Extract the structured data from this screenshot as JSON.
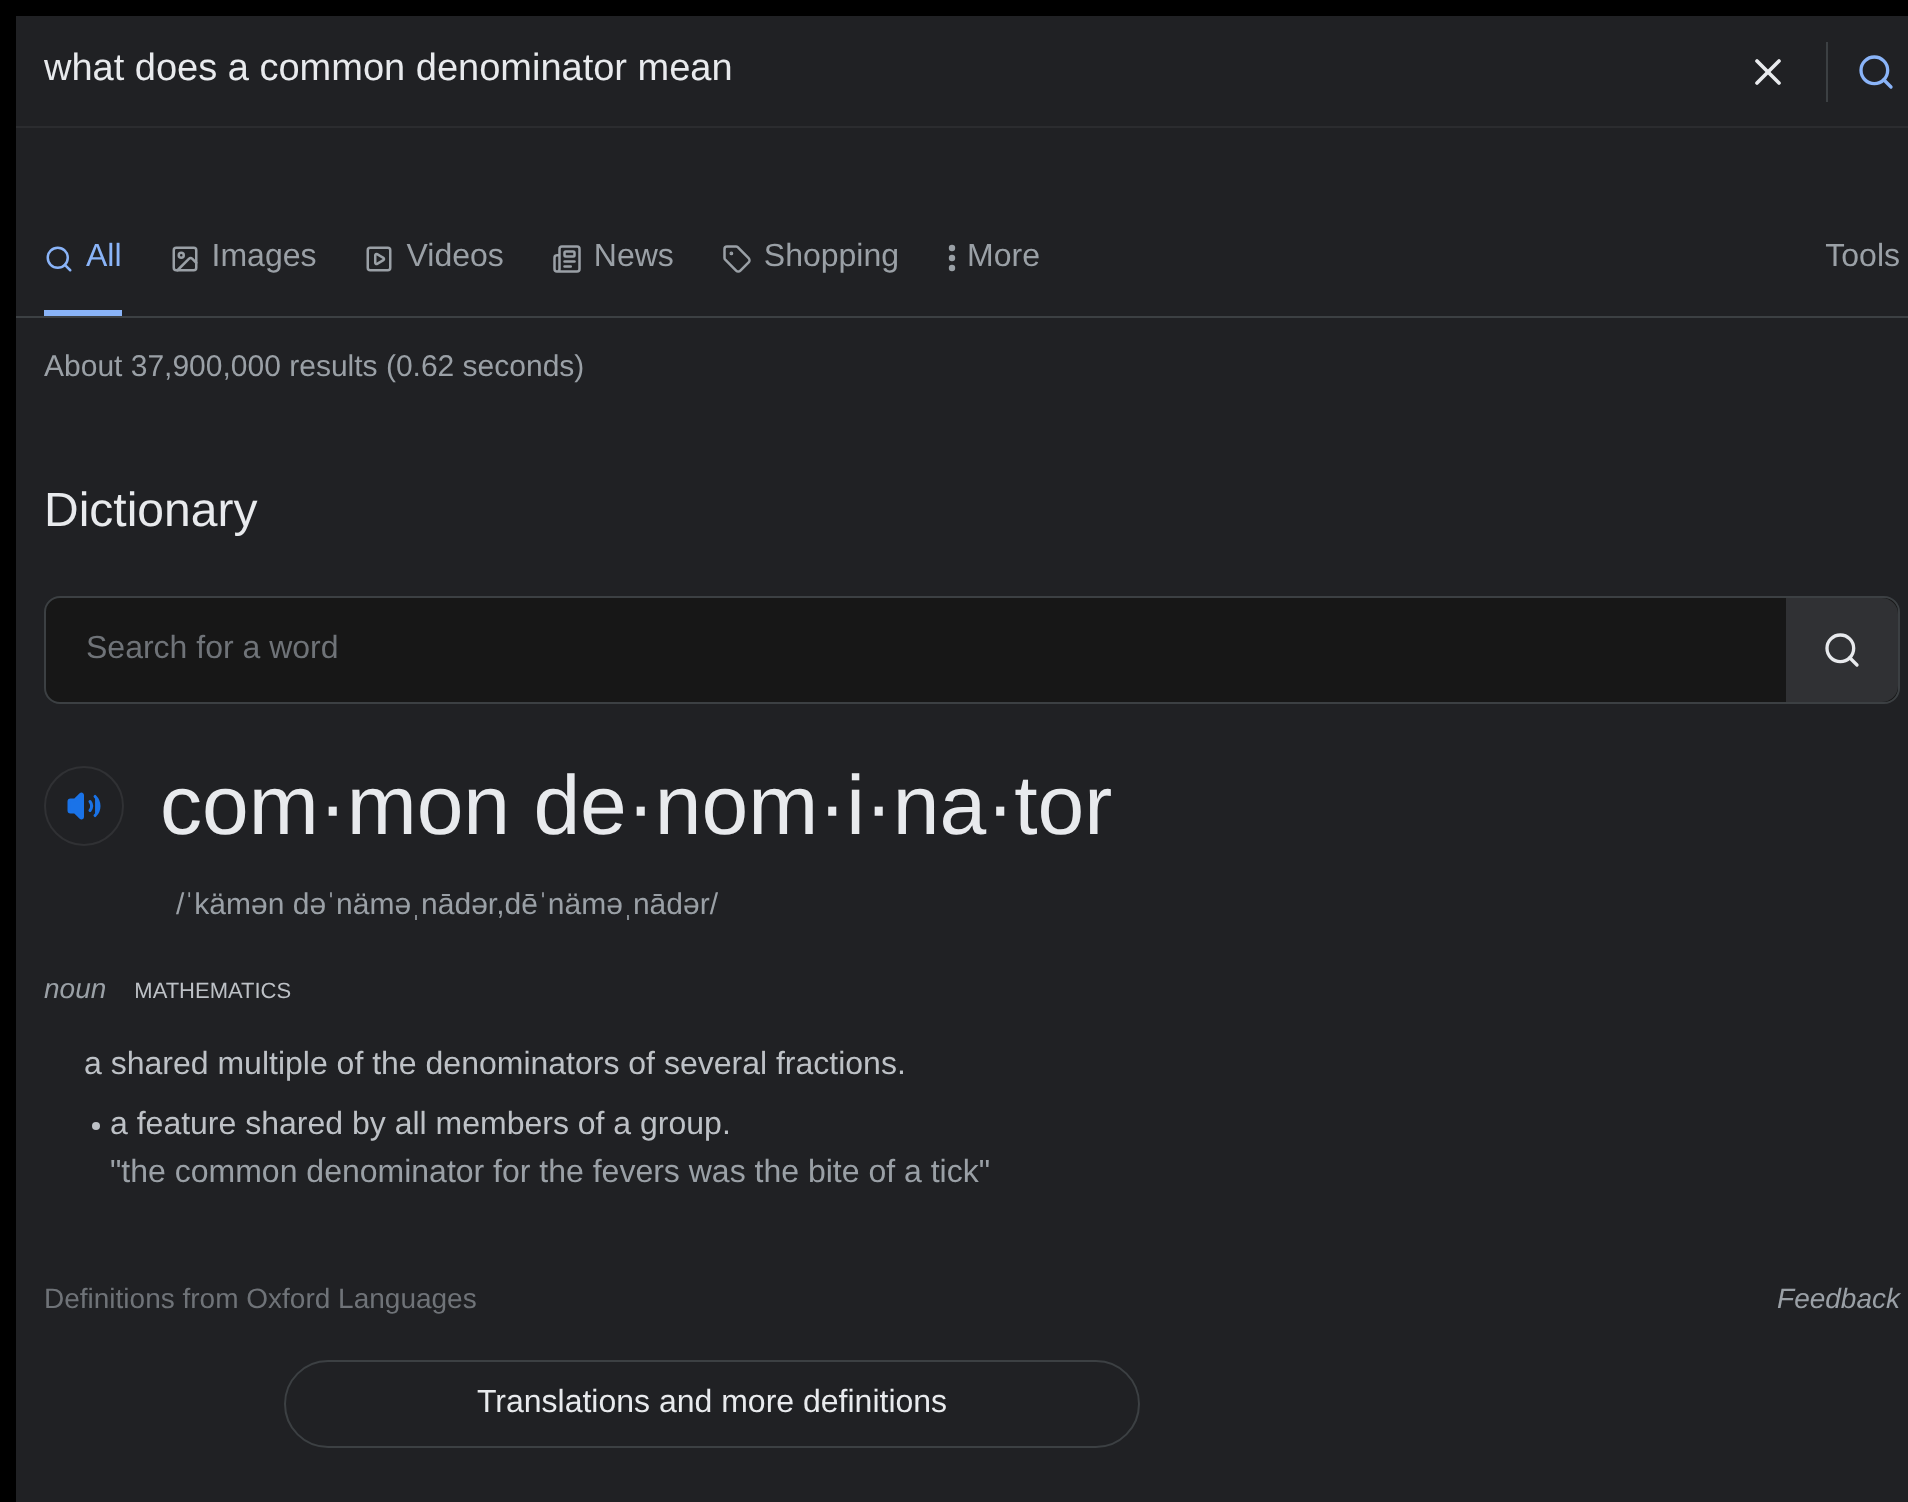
{
  "search": {
    "value": "what does a common denominator mean"
  },
  "tabs": [
    {
      "label": "All",
      "selected": true
    },
    {
      "label": "Images",
      "selected": false
    },
    {
      "label": "Videos",
      "selected": false
    },
    {
      "label": "News",
      "selected": false
    },
    {
      "label": "Shopping",
      "selected": false
    },
    {
      "label": "More",
      "selected": false
    }
  ],
  "tools": "Tools",
  "result_stats": "About 37,900,000 results (0.62 seconds)",
  "dictionary": {
    "title": "Dictionary",
    "search_placeholder": "Search for a word",
    "word": "com·mon de·nom·i·na·tor",
    "phonetic": "/ˈkämən dəˈnäməˌnādər,dēˈnäməˌnādər/",
    "part_of_speech": "noun",
    "domain": "MATHEMATICS",
    "definitions": [
      {
        "text": "a shared multiple of the denominators of several fractions.",
        "kind": "main"
      },
      {
        "text": "a feature shared by all members of a group.",
        "kind": "sub",
        "example": "\"the common denominator for the fevers was the bite of a tick\""
      }
    ],
    "source": "Definitions from Oxford Languages",
    "feedback": "Feedback",
    "more_button": "Translations and more definitions"
  }
}
